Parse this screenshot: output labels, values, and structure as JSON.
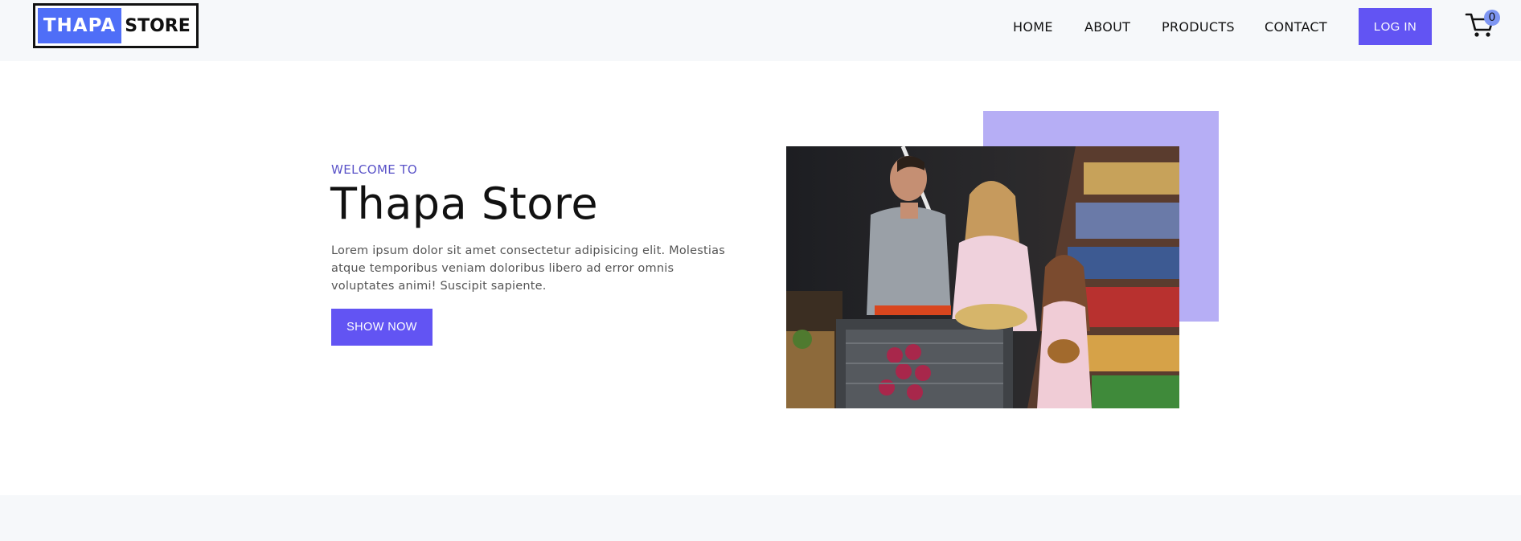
{
  "logo": {
    "left_text": "THAPA",
    "right_text": "STORE"
  },
  "nav": {
    "items": [
      {
        "label": "HOME"
      },
      {
        "label": "ABOUT"
      },
      {
        "label": "PRODUCTS"
      },
      {
        "label": "CONTACT"
      }
    ],
    "login_label": "LOG IN",
    "cart_icon": "cart-icon",
    "cart_count": "0"
  },
  "hero": {
    "welcome": "WELCOME TO",
    "title": "Thapa Store",
    "description": "Lorem ipsum dolor sit amet consectetur adipisicing elit. Molestias atque temporibus veniam doloribus libero ad error omnis voluptates animi! Suscipit sapiente.",
    "cta_label": "SHOW NOW",
    "image_subject": "family-shopping-in-grocery-store"
  },
  "colors": {
    "accent": "#6254f3",
    "logo_blue": "#4f6ef7",
    "hero_accent": "#b6aef5",
    "header_bg": "#f6f8fa"
  }
}
